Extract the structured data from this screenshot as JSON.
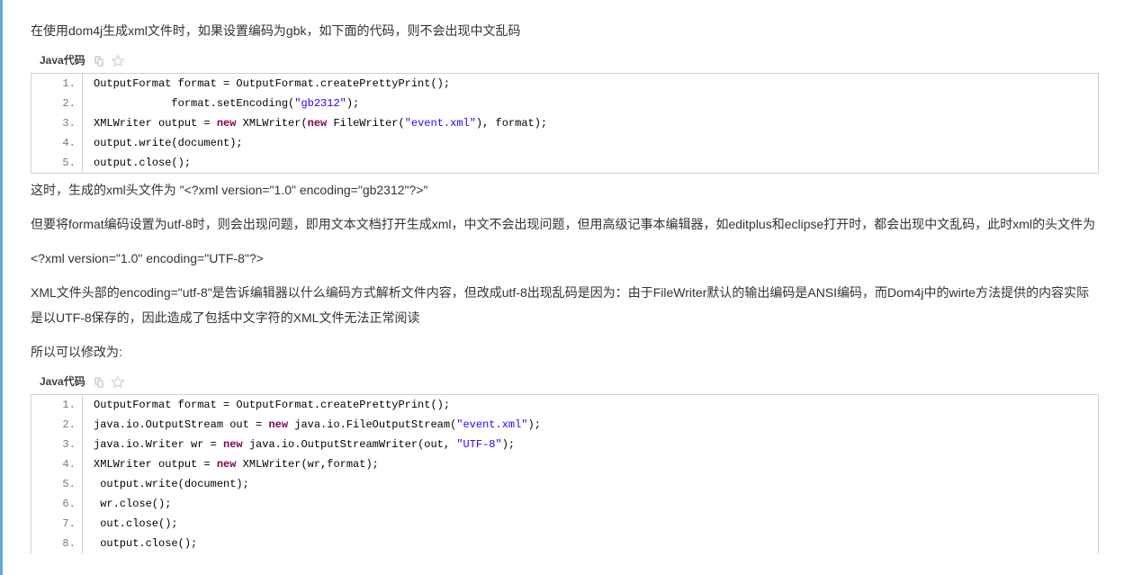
{
  "p1": "在使用dom4j生成xml文件时，如果设置编码为gbk，如下面的代码，则不会出现中文乱码",
  "caption": "Java代码",
  "code1": {
    "l1a": "OutputFormat format = OutputFormat.createPrettyPrint();  ",
    "l2a": "            format.setEncoding(",
    "l2s": "\"gb2312\"",
    "l2b": ");  ",
    "l3a": "XMLWriter output = ",
    "l3kw1": "new",
    "l3b": " XMLWriter(",
    "l3kw2": "new",
    "l3c": " FileWriter(",
    "l3s": "\"event.xml\"",
    "l3d": "), format);  ",
    "l4": "output.write(document);  ",
    "l5": "output.close();  "
  },
  "p2": "这时，生成的xml头文件为 \"<?xml version=\"1.0\" encoding=\"gb2312\"?>\"",
  "p3": "但要将format编码设置为utf-8时，则会出现问题，即用文本文档打开生成xml，中文不会出现问题，但用高级记事本编辑器，如editplus和eclipse打开时，都会出现中文乱码，此时xml的头文件为",
  "p4": "<?xml version=\"1.0\" encoding=\"UTF-8\"?>",
  "p5": "XML文件头部的encoding=\"utf-8\"是告诉编辑器以什么编码方式解析文件内容，但改成utf-8出现乱码是因为：由于FileWriter默认的输出编码是ANSI编码，而Dom4j中的wirte方法提供的内容实际是以UTF-8保存的，因此造成了包括中文字符的XML文件无法正常阅读",
  "p6": "所以可以修改为:",
  "code2": {
    "l1": "OutputFormat format = OutputFormat.createPrettyPrint();  ",
    "l2a": "java.io.OutputStream out = ",
    "l2kw": "new",
    "l2b": " java.io.FileOutputStream(",
    "l2s": "\"event.xml\"",
    "l2c": ");  ",
    "l3a": "java.io.Writer wr = ",
    "l3kw": "new",
    "l3b": " java.io.OutputStreamWriter(out, ",
    "l3s": "\"UTF-8\"",
    "l3c": ");  ",
    "l4a": "XMLWriter output = ",
    "l4kw": "new",
    "l4b": " XMLWriter(wr,format);  ",
    "l5": " output.write(document);  ",
    "l6": " wr.close();  ",
    "l7": " out.close();  ",
    "l8": " output.close();  "
  }
}
